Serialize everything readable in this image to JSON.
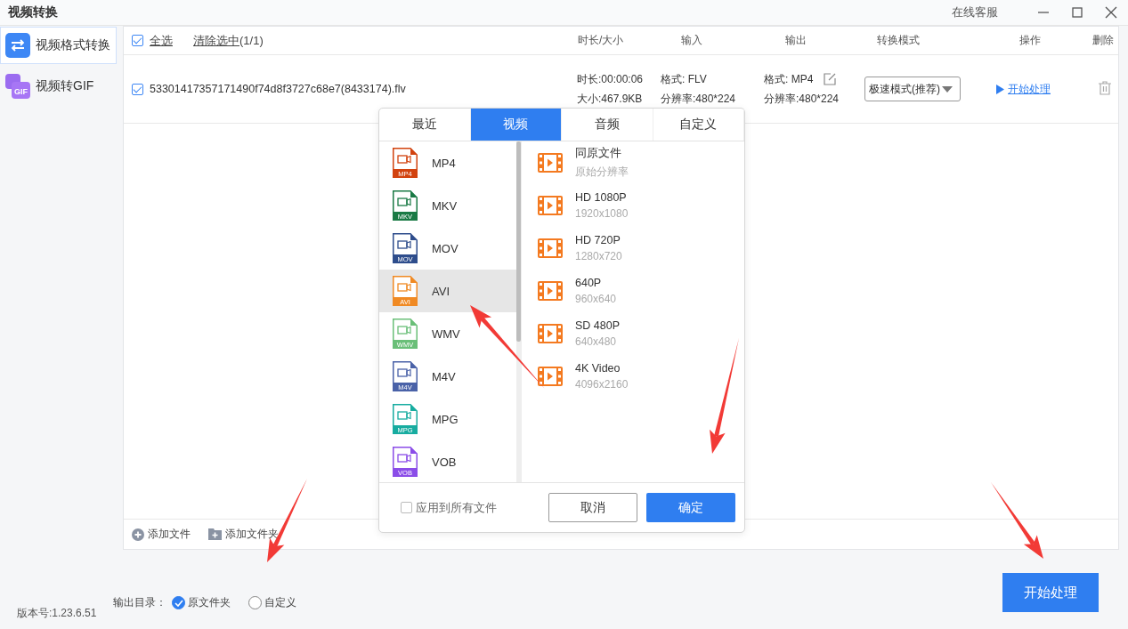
{
  "window": {
    "title": "视频转换",
    "link": "在线客服"
  },
  "sidebar": {
    "items": [
      {
        "label": "视频格式转换",
        "kind": "convert",
        "selected": true
      },
      {
        "label": "视频转GIF",
        "kind": "gif",
        "badge": "GIF",
        "selected": false
      }
    ]
  },
  "file_list": {
    "select_all": {
      "label": "全选",
      "checked": true
    },
    "clear_selection": "清除选中",
    "count": "(1/1)",
    "columns": [
      "时长/大小",
      "输入",
      "输出",
      "转换模式",
      "操作",
      "删除"
    ],
    "rows": [
      {
        "checked": true,
        "name": "53301417357171490f74d8f3727c68e7(8433174).flv",
        "duration": "时长:00:00:06",
        "size": "大小:467.9KB",
        "input_format": "格式: FLV",
        "input_resolution": "分辨率:480*224",
        "output_format": "格式: MP4",
        "output_resolution": "分辨率:480*224",
        "mode": "极速模式(推荐)",
        "action": "开始处理"
      }
    ],
    "add_buttons": [
      {
        "label": "添加文件",
        "kind": "file"
      },
      {
        "label": "添加文件夹",
        "kind": "folder"
      }
    ]
  },
  "format_popup": {
    "tabs": [
      {
        "label": "最近",
        "selected": false
      },
      {
        "label": "视频",
        "selected": true
      },
      {
        "label": "音频",
        "selected": false
      },
      {
        "label": "自定义",
        "selected": false
      }
    ],
    "formats": [
      {
        "label": "MP4",
        "badge": "MP4",
        "color": "#d2430f",
        "selected": false
      },
      {
        "label": "MKV",
        "badge": "MKV",
        "color": "#1a7a45",
        "selected": false
      },
      {
        "label": "MOV",
        "badge": "MOV",
        "color": "#2e4d8c",
        "selected": false
      },
      {
        "label": "AVI",
        "badge": "AVI",
        "color": "#f08a24",
        "selected": true
      },
      {
        "label": "WMV",
        "badge": "WMV",
        "color": "#6abf78",
        "selected": false
      },
      {
        "label": "M4V",
        "badge": "M4V",
        "color": "#4a62a8",
        "selected": false
      },
      {
        "label": "MPG",
        "badge": "MPG",
        "color": "#17aca0",
        "selected": false
      },
      {
        "label": "VOB",
        "badge": "VOB",
        "color": "#8b4de8",
        "selected": false
      }
    ],
    "presets": [
      {
        "name": "同原文件",
        "resolution": "原始分辨率"
      },
      {
        "name": "HD 1080P",
        "resolution": "1920x1080"
      },
      {
        "name": "HD 720P",
        "resolution": "1280x720"
      },
      {
        "name": "640P",
        "resolution": "960x640"
      },
      {
        "name": "SD 480P",
        "resolution": "640x480"
      },
      {
        "name": "4K Video",
        "resolution": "4096x2160"
      }
    ],
    "apply_all": {
      "label": "应用到所有文件",
      "checked": false
    },
    "buttons": [
      {
        "label": "取消",
        "kind": "secondary"
      },
      {
        "label": "确定",
        "kind": "primary"
      }
    ]
  },
  "output_dir": {
    "label": "输出目录：",
    "options": [
      {
        "label": "原文件夹",
        "selected": true
      },
      {
        "label": "自定义",
        "selected": false
      }
    ]
  },
  "start_button": "开始处理",
  "version": "版本号:1.23.6.51"
}
